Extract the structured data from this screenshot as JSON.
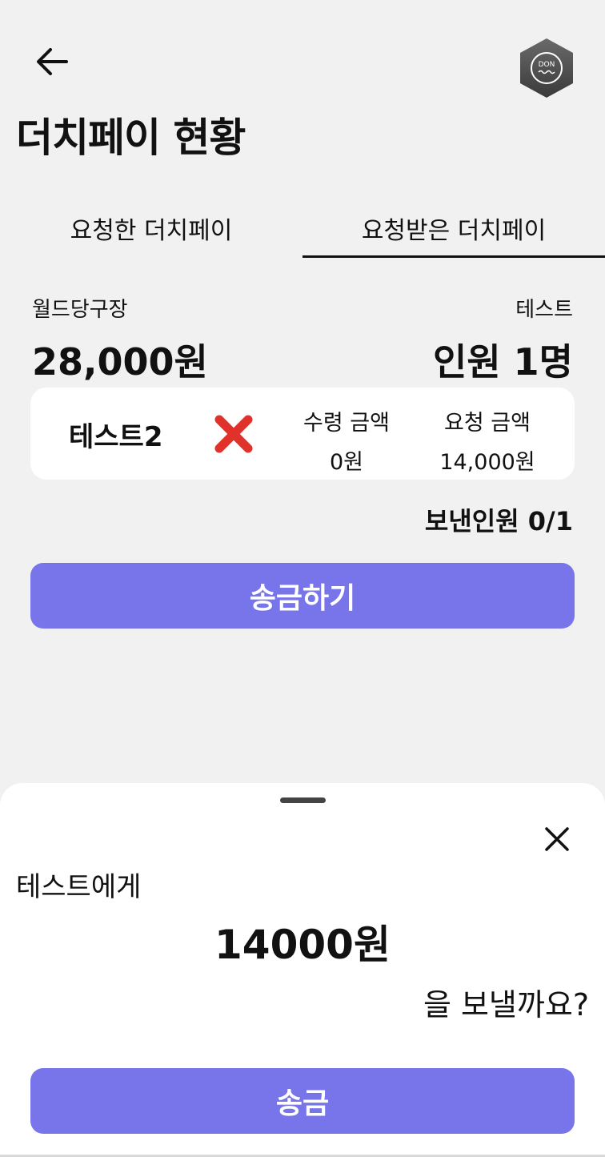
{
  "header": {
    "back_icon": "arrow-left-icon",
    "logo_text": "DON",
    "title": "더치페이 현황"
  },
  "tabs": [
    {
      "label": "요청한 더치페이",
      "active": false
    },
    {
      "label": "요청받은 더치페이",
      "active": true
    }
  ],
  "summary": {
    "store_name": "월드당구장",
    "requester": "테스트",
    "total_amount": "28,000원",
    "people_count": "인원 1명"
  },
  "member": {
    "name": "테스트2",
    "status_icon": "red-x-icon",
    "received_label": "수령 금액",
    "received_value": "0원",
    "requested_label": "요청 금액",
    "requested_value": "14,000원"
  },
  "sent_count": "보낸인원 0/1",
  "transfer_button": "송금하기",
  "sheet": {
    "close_icon": "close-icon",
    "recipient": "테스트에게",
    "amount": "14000원",
    "question": "을 보낼까요?",
    "send_button": "송금"
  },
  "colors": {
    "background": "#f2f1f2",
    "accent": "#7775e9",
    "status_red": "#e0322b",
    "card": "#ffffff"
  }
}
